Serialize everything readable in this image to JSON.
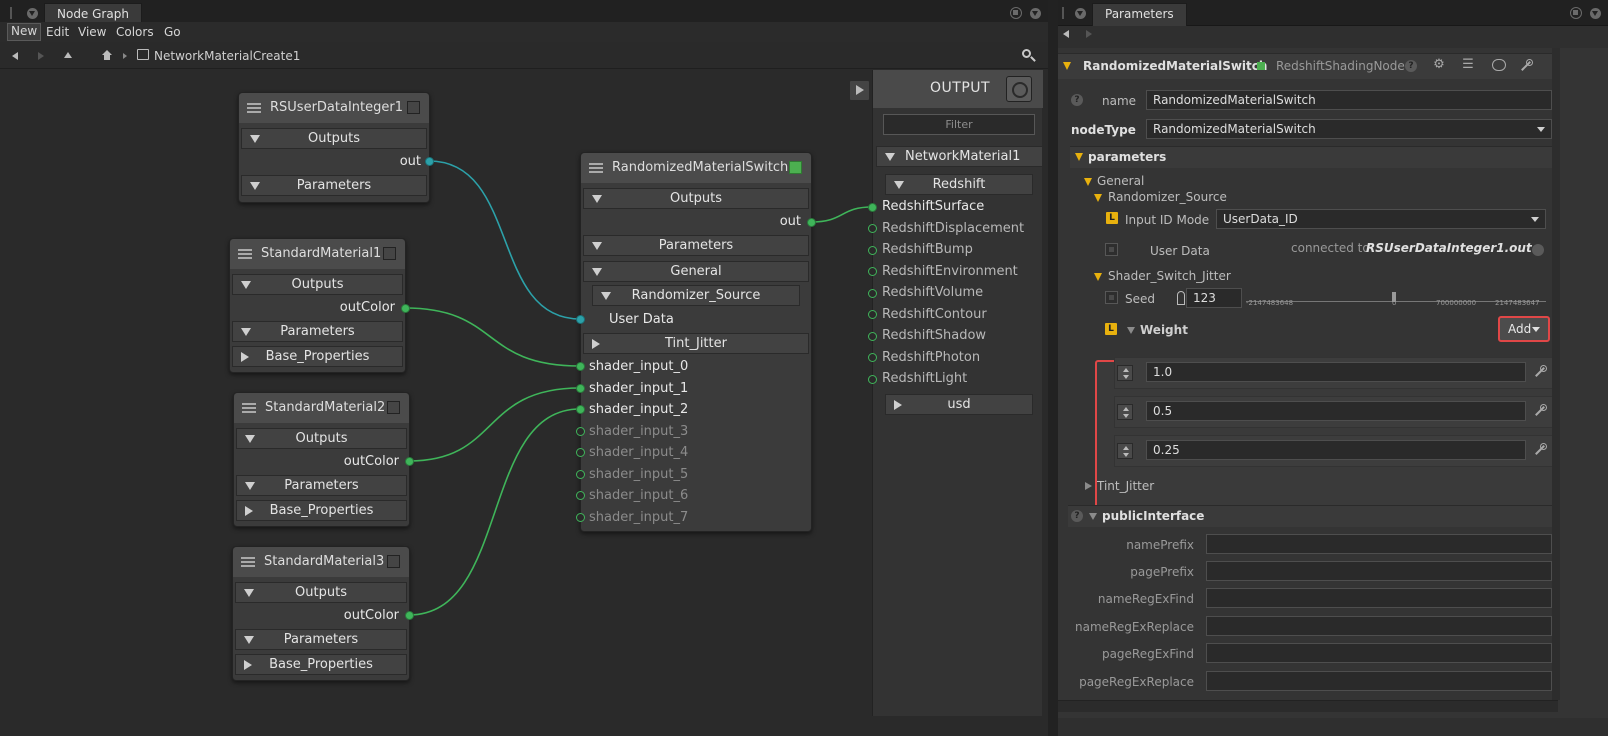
{
  "node_graph": {
    "tab_title": "Node Graph",
    "menu": [
      "New",
      "Edit",
      "View",
      "Colors",
      "Go"
    ],
    "breadcrumb": "NetworkMaterialCreate1",
    "nodes": {
      "rs_user_data": {
        "title": "RSUserDataInteger1",
        "outputs": "Outputs",
        "out_port": "out",
        "parameters": "Parameters"
      },
      "std1": {
        "title": "StandardMaterial1",
        "outputs": "Outputs",
        "out_port": "outColor",
        "parameters": "Parameters",
        "base": "Base_Properties"
      },
      "std2": {
        "title": "StandardMaterial2",
        "outputs": "Outputs",
        "out_port": "outColor",
        "parameters": "Parameters",
        "base": "Base_Properties"
      },
      "std3": {
        "title": "StandardMaterial3",
        "outputs": "Outputs",
        "out_port": "outColor",
        "parameters": "Parameters",
        "base": "Base_Properties"
      },
      "switch": {
        "title": "RandomizedMaterialSwitch",
        "outputs": "Outputs",
        "out_port": "out",
        "parameters": "Parameters",
        "general": "General",
        "randomizer_source": "Randomizer_Source",
        "user_data": "User Data",
        "tint_jitter": "Tint_Jitter",
        "inputs": [
          "shader_input_0",
          "shader_input_1",
          "shader_input_2",
          "shader_input_3",
          "shader_input_4",
          "shader_input_5",
          "shader_input_6",
          "shader_input_7"
        ]
      }
    },
    "output_panel": {
      "title": "OUTPUT",
      "filter_placeholder": "Filter",
      "network": "NetworkMaterial1",
      "group": "Redshift",
      "ports": [
        "RedshiftSurface",
        "RedshiftDisplacement",
        "RedshiftBump",
        "RedshiftEnvironment",
        "RedshiftVolume",
        "RedshiftContour",
        "RedshiftShadow",
        "RedshiftPhoton",
        "RedshiftLight"
      ],
      "usd": "usd"
    }
  },
  "parameters": {
    "tab_title": "Parameters",
    "header": {
      "node_name": "RandomizedMaterialSwitch",
      "node_type": "RedshiftShadingNode"
    },
    "name_label": "name",
    "name_value": "RandomizedMaterialSwitch",
    "node_type_label": "nodeType",
    "node_type_value": "RandomizedMaterialSwitch",
    "parameters_label": "parameters",
    "general_label": "General",
    "randomizer_source_label": "Randomizer_Source",
    "input_id_mode_label": "Input ID Mode",
    "input_id_mode_value": "UserData_ID",
    "user_data_label": "User Data",
    "connected_prefix": "connected to",
    "connected_target": "RSUserDataInteger1.out",
    "shader_switch_jitter_label": "Shader_Switch_Jitter",
    "seed_label": "Seed",
    "seed_value": "123",
    "slider_min": "-2147483648",
    "slider_mid": "0",
    "slider_q3": "700000000",
    "slider_max": "2147483647",
    "weight_label": "Weight",
    "add_label": "Add",
    "weights": [
      "1.0",
      "0.5",
      "0.25"
    ],
    "tint_jitter_label": "Tint_Jitter",
    "public_interface_label": "publicInterface",
    "public_fields": [
      "namePrefix",
      "pagePrefix",
      "nameRegExFind",
      "nameRegExReplace",
      "pageRegExFind",
      "pageRegExReplace"
    ],
    "badge_letter": "L",
    "help_glyph": "?"
  },
  "colors": {
    "wire_green": "#3fb55a",
    "wire_teal": "#2ca1a9",
    "highlight_red": "#e04747",
    "accent_yellow": "#e8b10e"
  }
}
